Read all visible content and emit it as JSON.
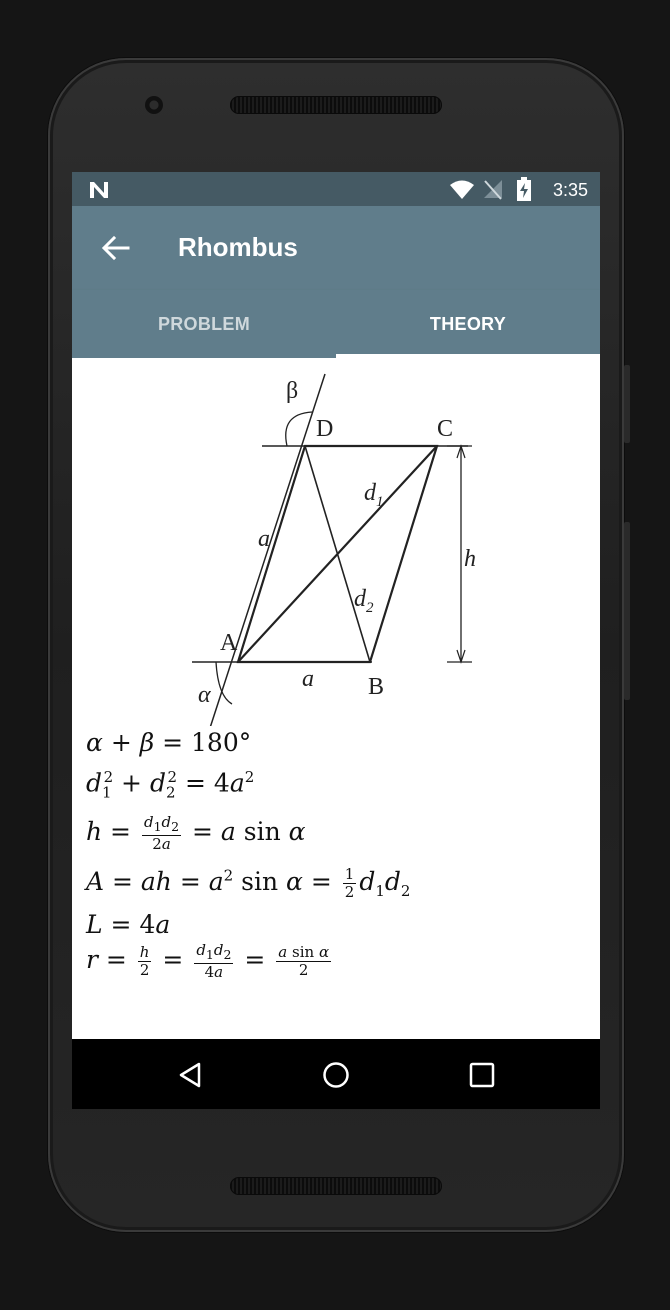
{
  "status_bar": {
    "time": "3:35",
    "icons": [
      "notification-n-icon",
      "wifi-icon",
      "no-signal-icon",
      "battery-charging-icon"
    ]
  },
  "app_bar": {
    "title": "Rhombus",
    "back_icon": "arrow-back-icon"
  },
  "tabs": [
    {
      "label": "PROBLEM",
      "selected": false
    },
    {
      "label": "THEORY",
      "selected": true
    }
  ],
  "diagram": {
    "vertices": [
      "A",
      "B",
      "C",
      "D"
    ],
    "side_label": "a",
    "diagonal_labels": [
      "d1",
      "d2"
    ],
    "height_label": "h",
    "angle_labels": [
      "α",
      "β"
    ]
  },
  "formulas": [
    "α + β = 180°",
    "d1² + d2² = 4a²",
    "h = d1d2/2a = a sin α",
    "A = ah = a² sin α = ½ d1d2",
    "L = 4a",
    "r = h/2 = d1d2/4a = a sin α/2"
  ],
  "nav_bar": {
    "icons": [
      "back-triangle-icon",
      "home-circle-icon",
      "recents-square-icon"
    ]
  },
  "colors": {
    "status_bar": "#455a64",
    "app_bar": "#607d8b",
    "tab_indicator": "#ffffff"
  }
}
